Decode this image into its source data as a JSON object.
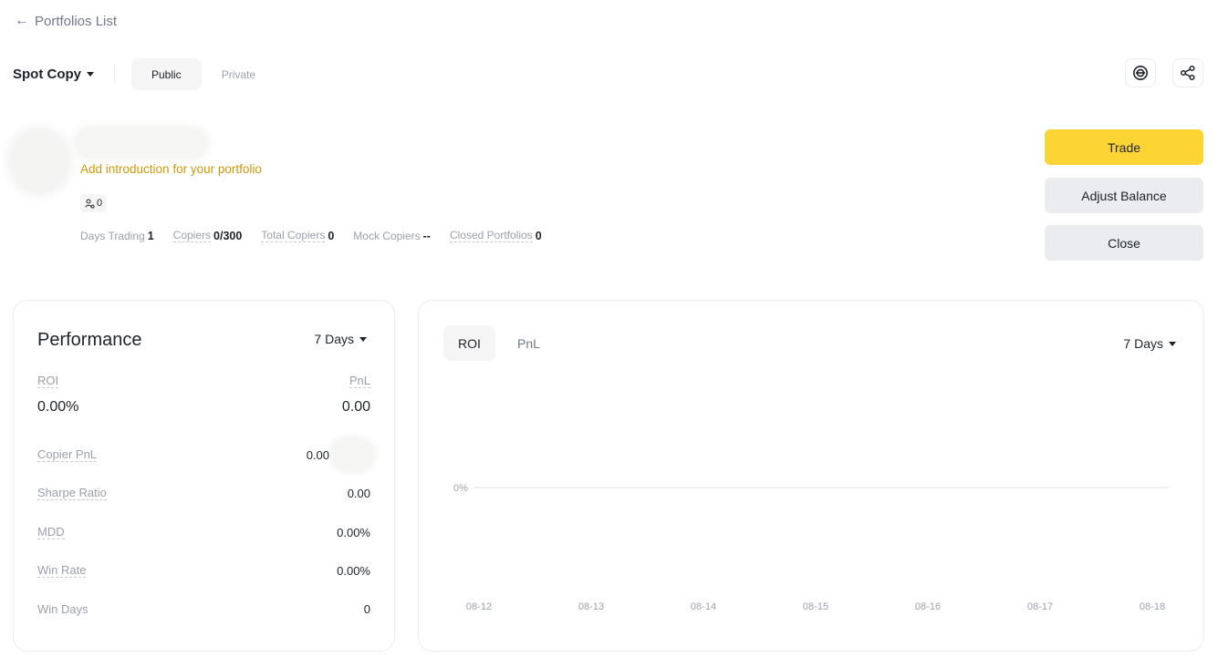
{
  "nav": {
    "back_arrow": "←",
    "back_label": "Portfolios List"
  },
  "header": {
    "mode_label": "Spot Copy",
    "tabs": [
      {
        "label": "Public",
        "active": true
      },
      {
        "label": "Private",
        "active": false
      }
    ],
    "icons": [
      "copy-trading-icon",
      "share-icon"
    ]
  },
  "profile": {
    "intro_link": "Add introduction for your portfolio",
    "followers_count": "0",
    "stats": [
      {
        "label": "Days Trading",
        "value": "1"
      },
      {
        "label": "Copiers",
        "value": "0/300"
      },
      {
        "label": "Total Copiers",
        "value": "0"
      },
      {
        "label": "Mock Copiers",
        "value": "--"
      },
      {
        "label": "Closed Portfolios",
        "value": "0"
      }
    ]
  },
  "actions": {
    "trade": "Trade",
    "adjust_balance": "Adjust Balance",
    "close": "Close"
  },
  "performance": {
    "title": "Performance",
    "period": "7 Days",
    "roi_label": "ROI",
    "roi_value": "0.00%",
    "pnl_label": "PnL",
    "pnl_value": "0.00",
    "metrics": [
      {
        "label": "Copier PnL",
        "value": "0.00"
      },
      {
        "label": "Sharpe Ratio",
        "value": "0.00"
      },
      {
        "label": "MDD",
        "value": "0.00%"
      },
      {
        "label": "Win Rate",
        "value": "0.00%"
      },
      {
        "label": "Win Days",
        "value": "0"
      }
    ]
  },
  "chart_panel": {
    "tabs": [
      {
        "label": "ROI",
        "active": true
      },
      {
        "label": "PnL",
        "active": false
      }
    ],
    "period": "7 Days"
  },
  "chart_data": {
    "type": "line",
    "x": [
      "08-12",
      "08-13",
      "08-14",
      "08-15",
      "08-16",
      "08-17",
      "08-18"
    ],
    "series": [
      {
        "values": [
          0,
          0,
          0,
          0,
          0,
          0,
          0
        ]
      }
    ],
    "y_tick_labels": [
      "0%"
    ],
    "grid": false,
    "colors": {
      "line": "#e6e8ea",
      "tick_text": "#9aa1ab"
    }
  },
  "colors": {
    "accent": "#fcd535",
    "link": "#d0980b",
    "secondary_button": "#eaecef"
  }
}
